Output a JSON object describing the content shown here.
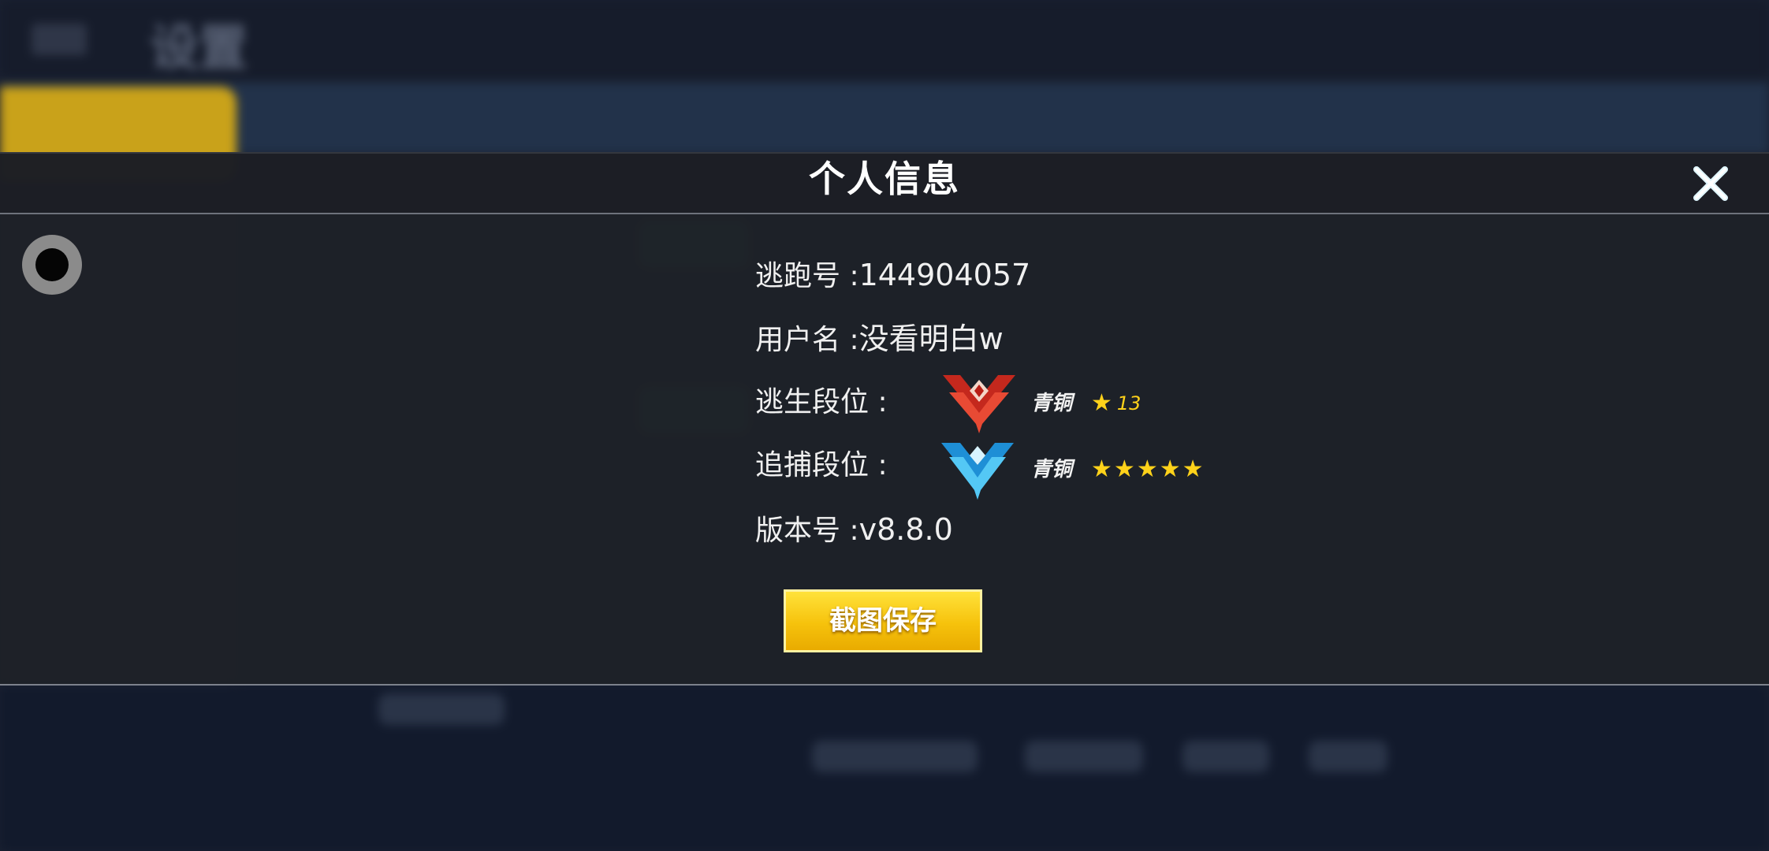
{
  "background": {
    "title": "设置"
  },
  "modal": {
    "title": "个人信息",
    "close_icon": "close-icon"
  },
  "info": {
    "account_label": "逃跑号 :",
    "account_value": "144904057",
    "username_label": "用户名 :",
    "username_value": "没看明白w",
    "escape_rank_label": "逃生段位 :",
    "escape_rank_name": "青铜",
    "escape_rank_star_count": "13",
    "escape_rank_emblem": "red-rank-emblem-icon",
    "escape_rank_color": "#d8362a",
    "chase_rank_label": "追捕段位 :",
    "chase_rank_name": "青铜",
    "chase_rank_stars": 5,
    "chase_rank_emblem": "blue-rank-emblem-icon",
    "chase_rank_color": "#35b6f0",
    "version_label": "版本号 :",
    "version_value": "v8.8.0"
  },
  "actions": {
    "save_screenshot_label": "截图保存"
  },
  "colors": {
    "accent_yellow": "#f6c20c",
    "star_yellow": "#ffd21a"
  }
}
